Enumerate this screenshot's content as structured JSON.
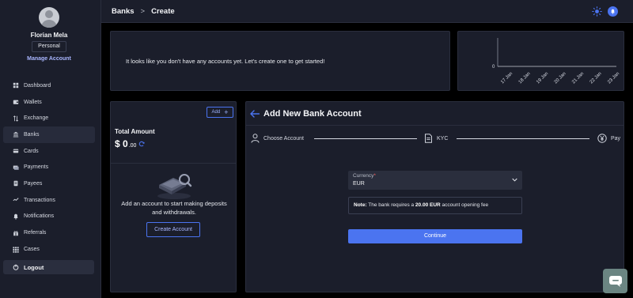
{
  "user": {
    "name": "Florian Mela",
    "account_type": "Personal",
    "manage_label": "Manage Account"
  },
  "nav": {
    "items": [
      {
        "label": "Dashboard",
        "icon": "dashboard-icon"
      },
      {
        "label": "Wallets",
        "icon": "wallet-icon"
      },
      {
        "label": "Exchange",
        "icon": "exchange-icon"
      },
      {
        "label": "Banks",
        "icon": "bank-icon",
        "active": true
      },
      {
        "label": "Cards",
        "icon": "card-icon"
      },
      {
        "label": "Payments",
        "icon": "payments-icon"
      },
      {
        "label": "Payees",
        "icon": "payees-icon"
      },
      {
        "label": "Transactions",
        "icon": "transactions-icon"
      },
      {
        "label": "Notifications",
        "icon": "bell-icon"
      },
      {
        "label": "Referrals",
        "icon": "referrals-icon"
      },
      {
        "label": "Cases",
        "icon": "grid-icon"
      }
    ],
    "logout_label": "Logout"
  },
  "header": {
    "breadcrumb_parent": "Banks",
    "breadcrumb_sep": ">",
    "breadcrumb_current": "Create"
  },
  "info": {
    "message": "It looks like you don't have any accounts yet. Let's create one to get started!"
  },
  "chart_data": {
    "type": "line",
    "categories": [
      "17 Jan",
      "18 Jan",
      "19 Jan",
      "20 Jan",
      "21 Jan",
      "22 Jan",
      "23 Jan"
    ],
    "values": [
      0,
      0,
      0,
      0,
      0,
      0,
      0
    ],
    "yticks": [
      "0"
    ],
    "grid": false
  },
  "accounts": {
    "add_label": "Add",
    "total_label": "Total Amount",
    "total_currency": "$",
    "total_whole": "0",
    "total_cents": ".00",
    "empty_text": "Add an account to start making deposits and withdrawals.",
    "create_label": "Create Account"
  },
  "form": {
    "title": "Add New Bank Account",
    "steps": [
      "Choose Account",
      "KYC",
      "Pay"
    ],
    "currency_label": "Currency",
    "currency_required": "*",
    "currency_value": "EUR",
    "note_prefix": "Note:",
    "note_text": " The bank requires a ",
    "note_amount": "20.00 EUR",
    "note_suffix": " account opening fee",
    "continue_label": "Continue"
  },
  "colors": {
    "accent": "#4b74f0",
    "panel": "#1b1e2b",
    "background": "#000000",
    "chat": "#6b8582"
  }
}
